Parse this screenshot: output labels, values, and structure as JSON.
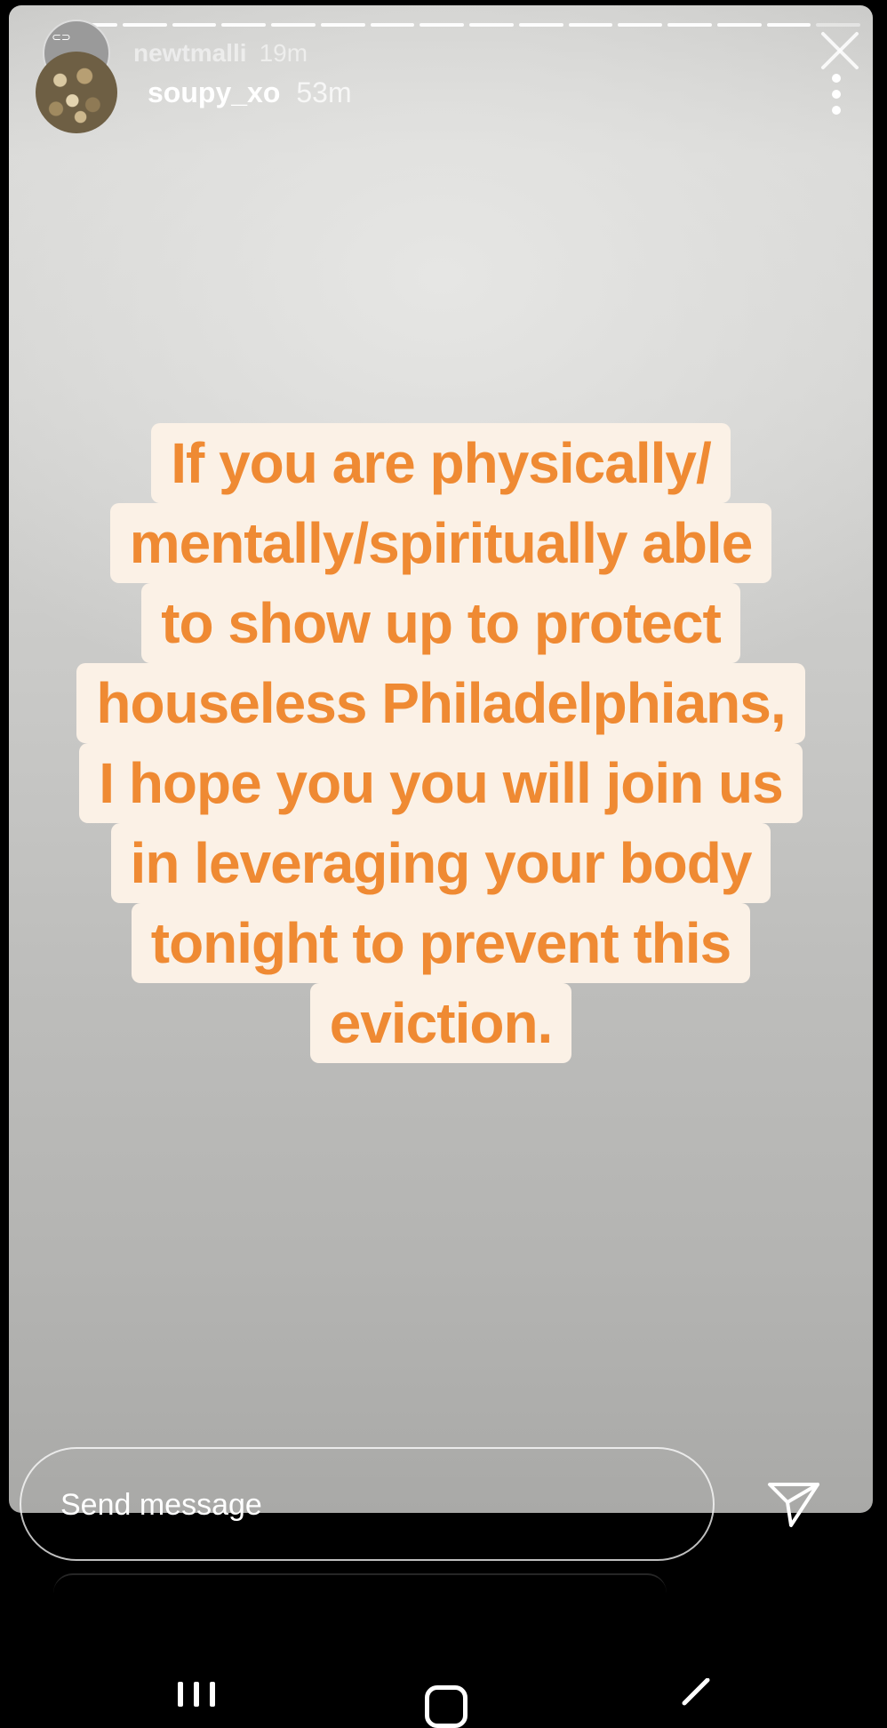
{
  "story": {
    "progress_segments_total": 16,
    "progress_segments_viewed": 15,
    "previous_user": {
      "username": "newtmalli",
      "time": "19m"
    },
    "current_user": {
      "username": "soupy_xo",
      "time": "53m",
      "avatar_icon": "avatar-photo"
    },
    "quote_lines": [
      "If you are physically/",
      "mentally/spiritually able",
      "to show up to protect",
      "houseless Philadelphians,",
      "I hope you you will join us",
      "in leveraging your body",
      "tonight to prevent this",
      "eviction."
    ],
    "colors": {
      "quote_text": "#ef8a33",
      "quote_bg": "#fbf1e6"
    }
  },
  "composer": {
    "placeholder": "Send message",
    "send_icon": "send-icon"
  },
  "navbar": {
    "recents_icon": "recents-icon",
    "home_icon": "home-icon",
    "back_icon": "back-icon"
  }
}
